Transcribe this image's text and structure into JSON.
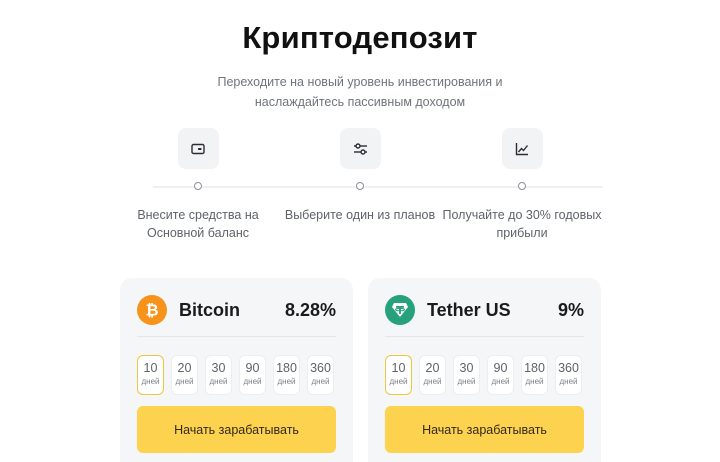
{
  "page": {
    "title": "Криптодепозит",
    "subtitle": "Переходите на новый уровень инвестирования и наслаждайтесь пассивным доходом"
  },
  "steps": [
    {
      "icon": "wallet-icon",
      "text": "Внесите средства на Основной баланс"
    },
    {
      "icon": "sliders-icon",
      "text": "Выберите один из планов"
    },
    {
      "icon": "line-chart-icon",
      "text": "Получайте до 30% годовых прибыли"
    }
  ],
  "cards": [
    {
      "coin_icon": "bitcoin-icon",
      "coin_color": "#f7931a",
      "name": "Bitcoin",
      "rate": "8.28%",
      "periods": [
        {
          "num": "10",
          "unit": "дней",
          "active": true
        },
        {
          "num": "20",
          "unit": "дней"
        },
        {
          "num": "30",
          "unit": "дней"
        },
        {
          "num": "90",
          "unit": "дней"
        },
        {
          "num": "180",
          "unit": "дней"
        },
        {
          "num": "360",
          "unit": "дней"
        }
      ],
      "cta": "Начать зарабатывать"
    },
    {
      "coin_icon": "tether-icon",
      "coin_color": "#26a17b",
      "name": "Tether US",
      "rate": "9%",
      "periods": [
        {
          "num": "10",
          "unit": "дней",
          "active": true
        },
        {
          "num": "20",
          "unit": "дней"
        },
        {
          "num": "30",
          "unit": "дней"
        },
        {
          "num": "90",
          "unit": "дней"
        },
        {
          "num": "180",
          "unit": "дней"
        },
        {
          "num": "360",
          "unit": "дней"
        }
      ],
      "cta": "Начать зарабатывать"
    }
  ],
  "colors": {
    "accent": "#fcd24f",
    "active_border": "#f0c542",
    "card_bg": "#f5f6f8"
  }
}
